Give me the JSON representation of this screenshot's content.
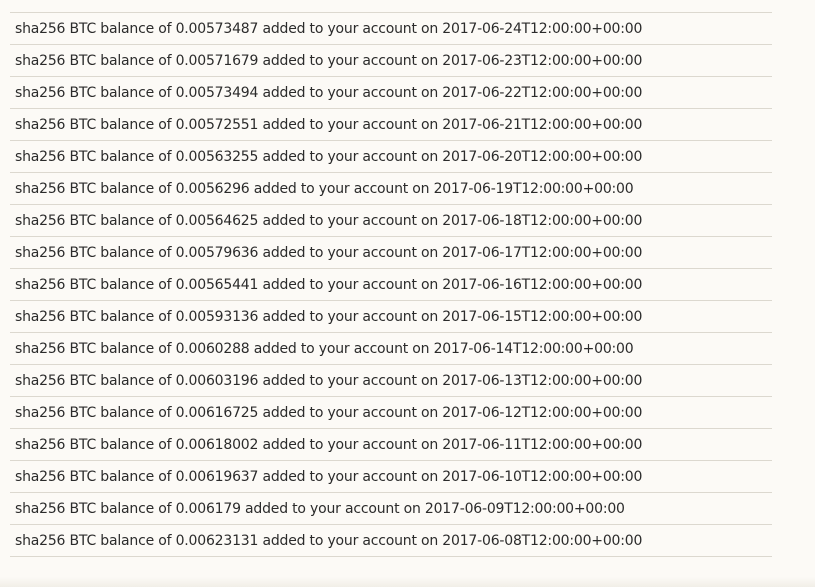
{
  "transactions": [
    "sha256 BTC balance of 0.00573487 added to your account on 2017-06-24T12:00:00+00:00",
    "sha256 BTC balance of 0.00571679 added to your account on 2017-06-23T12:00:00+00:00",
    "sha256 BTC balance of 0.00573494 added to your account on 2017-06-22T12:00:00+00:00",
    "sha256 BTC balance of 0.00572551 added to your account on 2017-06-21T12:00:00+00:00",
    "sha256 BTC balance of 0.00563255 added to your account on 2017-06-20T12:00:00+00:00",
    "sha256 BTC balance of 0.0056296 added to your account on 2017-06-19T12:00:00+00:00",
    "sha256 BTC balance of 0.00564625 added to your account on 2017-06-18T12:00:00+00:00",
    "sha256 BTC balance of 0.00579636 added to your account on 2017-06-17T12:00:00+00:00",
    "sha256 BTC balance of 0.00565441 added to your account on 2017-06-16T12:00:00+00:00",
    "sha256 BTC balance of 0.00593136 added to your account on 2017-06-15T12:00:00+00:00",
    "sha256 BTC balance of 0.0060288 added to your account on 2017-06-14T12:00:00+00:00",
    "sha256 BTC balance of 0.00603196 added to your account on 2017-06-13T12:00:00+00:00",
    "sha256 BTC balance of 0.00616725 added to your account on 2017-06-12T12:00:00+00:00",
    "sha256 BTC balance of 0.00618002 added to your account on 2017-06-11T12:00:00+00:00",
    "sha256 BTC balance of 0.00619637 added to your account on 2017-06-10T12:00:00+00:00",
    "sha256 BTC balance of 0.006179 added to your account on 2017-06-09T12:00:00+00:00",
    "sha256 BTC balance of 0.00623131 added to your account on 2017-06-08T12:00:00+00:00"
  ]
}
